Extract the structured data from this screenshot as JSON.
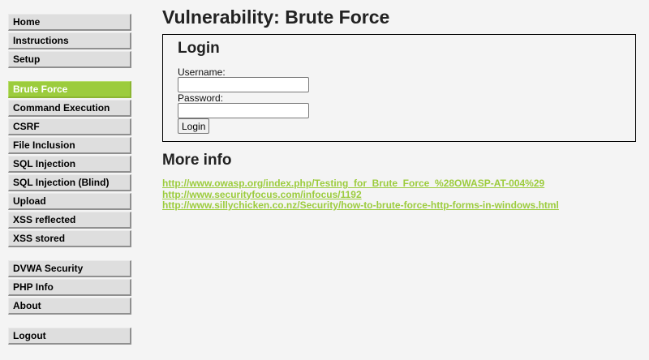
{
  "sidebar": {
    "groups": [
      [
        {
          "label": "Home"
        },
        {
          "label": "Instructions"
        },
        {
          "label": "Setup"
        }
      ],
      [
        {
          "label": "Brute Force",
          "selected": true
        },
        {
          "label": "Command Execution"
        },
        {
          "label": "CSRF"
        },
        {
          "label": "File Inclusion"
        },
        {
          "label": "SQL Injection"
        },
        {
          "label": "SQL Injection (Blind)"
        },
        {
          "label": "Upload"
        },
        {
          "label": "XSS reflected"
        },
        {
          "label": "XSS stored"
        }
      ],
      [
        {
          "label": "DVWA Security"
        },
        {
          "label": "PHP Info"
        },
        {
          "label": "About"
        }
      ],
      [
        {
          "label": "Logout"
        }
      ]
    ]
  },
  "page": {
    "title": "Vulnerability: Brute Force"
  },
  "login_form": {
    "heading": "Login",
    "username_label": "Username:",
    "username_value": "",
    "password_label": "Password:",
    "password_value": "",
    "submit_label": "Login"
  },
  "more_info": {
    "heading": "More info",
    "links": [
      "http://www.owasp.org/index.php/Testing_for_Brute_Force_%28OWASP-AT-004%29",
      "http://www.securityfocus.com/infocus/1192",
      "http://www.sillychicken.co.nz/Security/how-to-brute-force-http-forms-in-windows.html"
    ]
  },
  "colors": {
    "accent": "#9ccc3d",
    "background": "#f4f4f4",
    "menu_button": "#dedede"
  }
}
